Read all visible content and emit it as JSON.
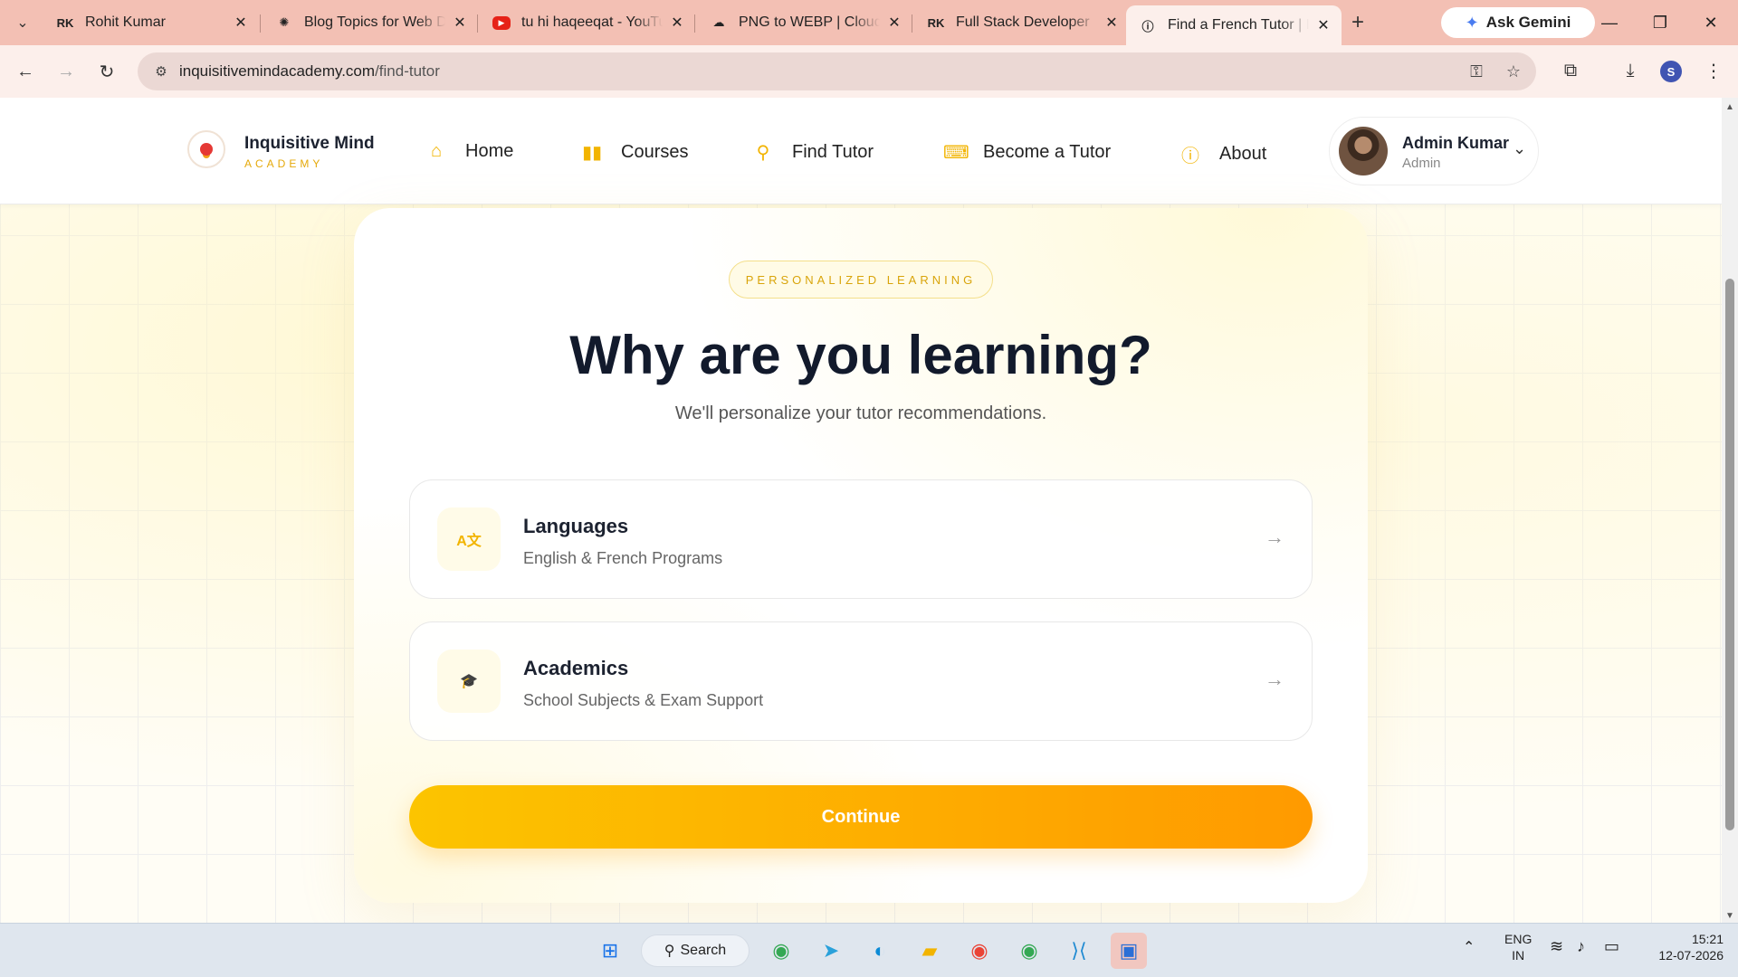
{
  "browser": {
    "tabs": [
      {
        "title": "Rohit Kumar",
        "favicon": "RK"
      },
      {
        "title": "Blog Topics for Web D",
        "favicon": "openai-icon"
      },
      {
        "title": "tu hi haqeeqat - YouTu",
        "favicon": "youtube-icon"
      },
      {
        "title": "PNG to WEBP | CloudC",
        "favicon": "cloud-icon"
      },
      {
        "title": "Full Stack Developer",
        "favicon": "RK"
      },
      {
        "title": "Find a French Tutor | In",
        "favicon": "site-icon",
        "active": true
      }
    ],
    "ask_gemini": "Ask Gemini",
    "url_domain": "inquisitivemindacademy.com",
    "url_path": "/find-tutor",
    "profile_initial": "S"
  },
  "site": {
    "brand_name": "Inquisitive Mind",
    "brand_sub": "ACADEMY",
    "nav": [
      {
        "label": "Home",
        "icon": "home-icon"
      },
      {
        "label": "Courses",
        "icon": "book-icon"
      },
      {
        "label": "Find Tutor",
        "icon": "search-icon"
      },
      {
        "label": "Become a Tutor",
        "icon": "teacher-icon"
      },
      {
        "label": "About",
        "icon": "info-icon"
      }
    ],
    "user": {
      "name": "Admin Kumar",
      "role": "Admin"
    }
  },
  "main": {
    "badge": "PERSONALIZED LEARNING",
    "title": "Why are you learning?",
    "subtitle": "We'll personalize your tutor recommendations.",
    "options": [
      {
        "title": "Languages",
        "subtitle": "English & French Programs",
        "icon": "language-icon"
      },
      {
        "title": "Academics",
        "subtitle": "School Subjects & Exam Support",
        "icon": "graduation-cap-icon"
      }
    ],
    "continue_label": "Continue"
  },
  "taskbar": {
    "search_label": "Search",
    "lang_top": "ENG",
    "lang_bottom": "IN",
    "time": "15:21",
    "date": "12-07-2026"
  },
  "colors": {
    "accent": "#f2b400",
    "cta_start": "#fcc400",
    "cta_end": "#ff9a00",
    "tabbar": "#f3c0b4"
  }
}
